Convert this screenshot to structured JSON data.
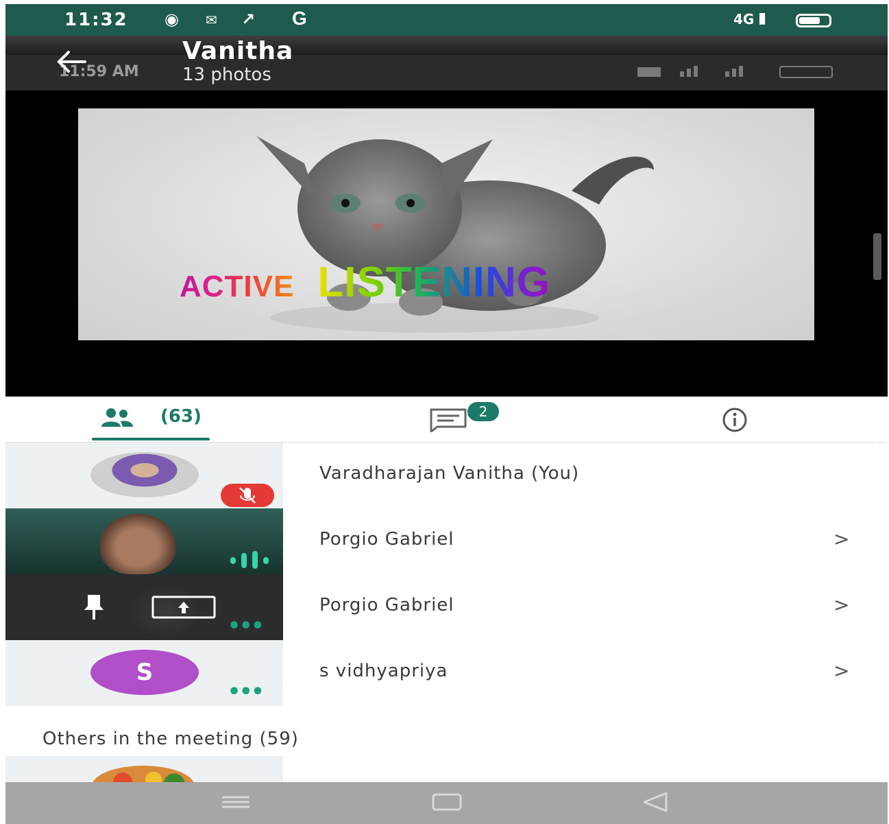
{
  "status_bar": {
    "time": "11:32",
    "network_label": "4G",
    "icons": [
      "chrome-icon",
      "gmail-icon",
      "missed-call-icon",
      "google-icon",
      "signal-icon",
      "battery-icon"
    ]
  },
  "header": {
    "title": "Vanitha",
    "subtitle": "13 photos",
    "overlay_time": "11:59 AM"
  },
  "slide": {
    "text_word_1": "ACTIVE",
    "text_word_2": "LISTENING"
  },
  "tabs": {
    "people_count": "(63)",
    "chat_badge": "2"
  },
  "participants": [
    {
      "name": "Varadharajan Vanitha (You)",
      "muted": true
    },
    {
      "name": "Porgio Gabriel",
      "speaking": true
    },
    {
      "name": "Porgio Gabriel",
      "presenting": true
    },
    {
      "name": "s vidhyapriya",
      "initial": "S",
      "avatar_color": "#b04fc8"
    }
  ],
  "others_section": {
    "title": "Others in the meeting (59)"
  },
  "colors": {
    "status_bar": "#1e5a4d",
    "accent": "#1d7a68",
    "muted_badge": "#e53935"
  }
}
